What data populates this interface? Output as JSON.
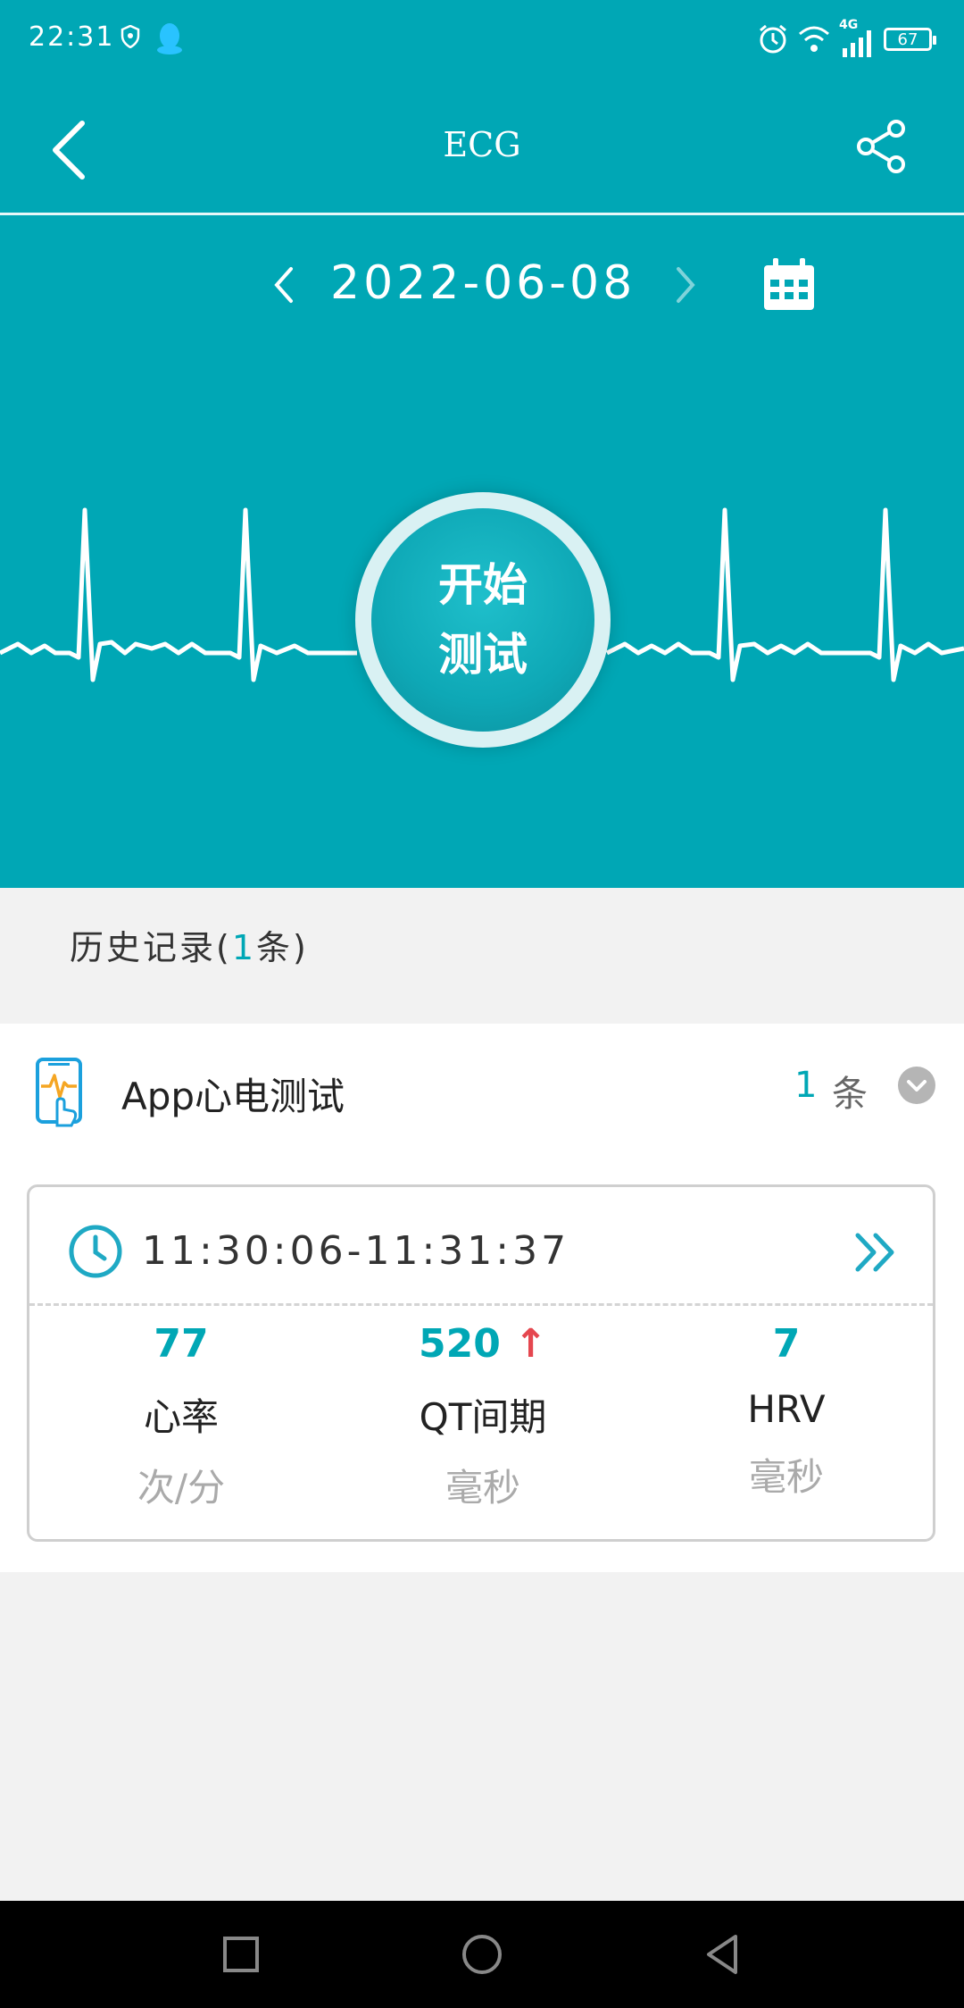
{
  "status_bar": {
    "time": "22:31",
    "network": "4G",
    "battery": "67"
  },
  "app_bar": {
    "title": "ECG"
  },
  "date_nav": {
    "date": "2022-06-08"
  },
  "start_button": {
    "line1": "开始",
    "line2": "测试"
  },
  "history": {
    "prefix": "历史记录(",
    "count": "1",
    "suffix": "条)"
  },
  "group": {
    "title": "App心电测试",
    "count": "1",
    "unit": "条"
  },
  "record": {
    "time_range": "11:30:06-11:31:37",
    "metrics": [
      {
        "value": "77",
        "label": "心率",
        "unit": "次/分"
      },
      {
        "value": "520",
        "label": "QT间期",
        "unit": "毫秒",
        "flag": "↑"
      },
      {
        "value": "7",
        "label": "HRV",
        "unit": "毫秒"
      }
    ]
  },
  "colors": {
    "primary": "#00a7b5",
    "alert": "#e5474f",
    "background": "#f2f2f2"
  }
}
